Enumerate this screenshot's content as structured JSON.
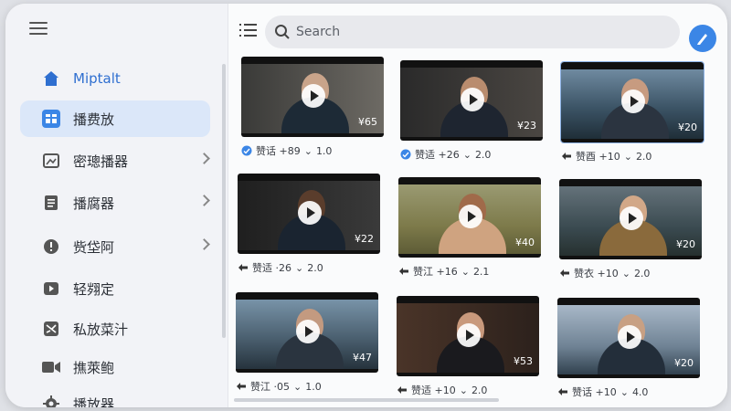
{
  "sidebar": {
    "items": [
      {
        "label": "Miptalt",
        "icon": "home-icon"
      },
      {
        "label": "播费放",
        "icon": "grid-app-icon"
      },
      {
        "label": "密璁播器",
        "icon": "picture-icon"
      },
      {
        "label": "播腐器",
        "icon": "document-icon"
      },
      {
        "label": "赀垈阿",
        "icon": "alert-icon"
      },
      {
        "label": "轻翙定",
        "icon": "video-icon"
      },
      {
        "label": "私放菜汁",
        "icon": "shuffle-icon"
      },
      {
        "label": "撨萊鲍",
        "icon": "camera-icon"
      },
      {
        "label": "播放器",
        "icon": "gear-icon"
      }
    ]
  },
  "search": {
    "placeholder": "Search"
  },
  "colors": {
    "accent": "#3b86e6",
    "active_bg": "#dbe7f9"
  },
  "videos": [
    {
      "duration": "¥65",
      "meta": "赞话 +89",
      "version": "1.0"
    },
    {
      "duration": "¥23",
      "meta": "赞适 +26",
      "version": "2.0"
    },
    {
      "duration": "¥20",
      "meta": "赞酉 +10",
      "version": "2.0"
    },
    {
      "duration": "¥22",
      "meta": "赞适 ·26",
      "version": "2.0"
    },
    {
      "duration": "¥40",
      "meta": "赞江 +16",
      "version": "2.1"
    },
    {
      "duration": "¥20",
      "meta": "赞衣 +10",
      "version": "2.0"
    },
    {
      "duration": "¥47",
      "meta": "赞江 ·05",
      "version": "1.0"
    },
    {
      "duration": "¥53",
      "meta": "赞适 +10",
      "version": "2.0"
    },
    {
      "duration": "¥20",
      "meta": "赞话 +10",
      "version": "4.0"
    }
  ]
}
